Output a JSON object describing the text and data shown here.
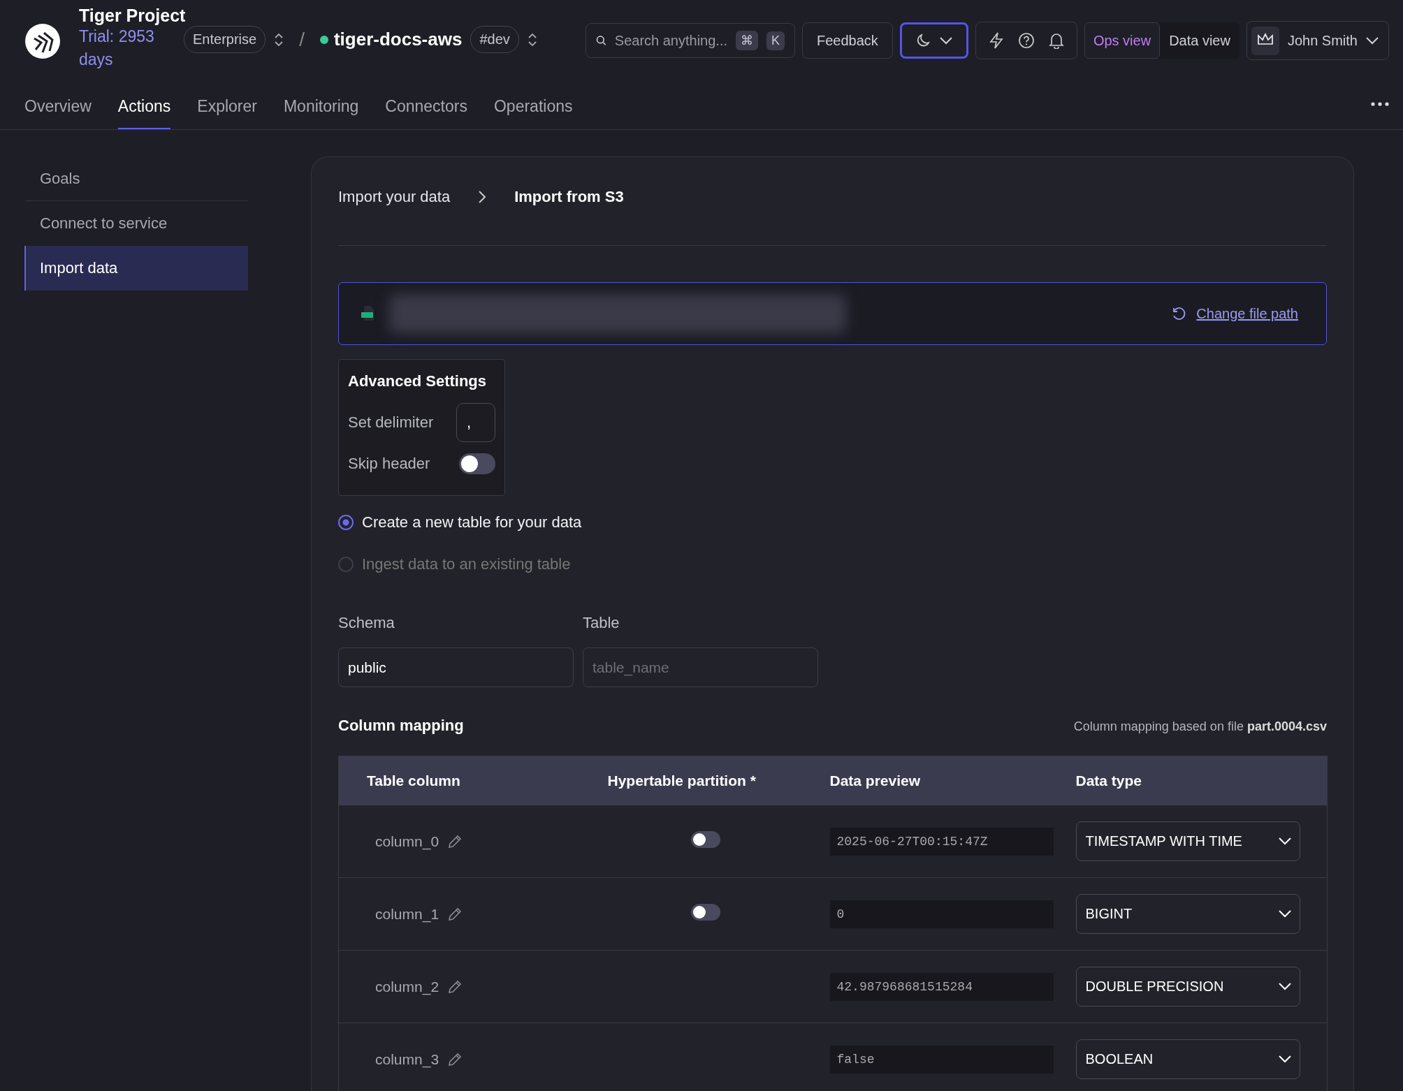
{
  "header": {
    "project_name": "Tiger Project",
    "trial": "Trial: 2953 days",
    "plan": "Enterprise",
    "separator": "/",
    "service": {
      "name": "tiger-docs-aws",
      "color": "#3ec99a",
      "tag": "#dev"
    },
    "search": {
      "placeholder": "Search anything...",
      "shortcut": [
        "⌘",
        "K"
      ]
    },
    "feedback": "Feedback",
    "theme_menu": {
      "focused": true
    },
    "views": [
      {
        "label": "Ops view",
        "selected": true
      },
      {
        "label": "Data view",
        "selected": false
      }
    ],
    "user": {
      "name": "John Smith"
    }
  },
  "tabs": [
    {
      "label": "Overview",
      "selected": false
    },
    {
      "label": "Actions",
      "selected": true
    },
    {
      "label": "Explorer",
      "selected": false
    },
    {
      "label": "Monitoring",
      "selected": false
    },
    {
      "label": "Connectors",
      "selected": false
    },
    {
      "label": "Operations",
      "selected": false
    }
  ],
  "sidebar": {
    "items": [
      {
        "label": "Goals",
        "selected": false
      },
      {
        "label": "Connect to service",
        "selected": false
      },
      {
        "label": "Import data",
        "selected": true
      }
    ]
  },
  "breadcrumb": [
    {
      "label": "Import your data",
      "current": false
    },
    {
      "label": "Import from S3",
      "current": true
    }
  ],
  "file": {
    "link": "Change file path"
  },
  "advanced": {
    "title": "Advanced Settings",
    "delimiter": {
      "label": "Set delimiter",
      "value": ","
    },
    "skip_header": {
      "label": "Skip header",
      "on": false
    }
  },
  "target_options": [
    {
      "label": "Create a new table for your data",
      "selected": true
    },
    {
      "label": "Ingest data to an existing table",
      "selected": false
    }
  ],
  "schema": {
    "label": "Schema",
    "value": "public"
  },
  "table": {
    "label": "Table",
    "placeholder": "table_name"
  },
  "column_mapping": {
    "title": "Column mapping",
    "note": "Column mapping based on file **part.0004.csv**",
    "columns": [
      "Table column",
      "Hypertable partition *",
      "Data preview",
      "Data type"
    ],
    "rows": [
      {
        "name": "column_0",
        "partition": {
          "on": false
        },
        "preview": "2025-06-27T00:15:47Z",
        "type": "TIMESTAMP WITH TIME"
      },
      {
        "name": "column_1",
        "partition": {
          "on": false
        },
        "preview": "0",
        "type": "BIGINT"
      },
      {
        "name": "column_2",
        "preview": "42.987968681515284",
        "type": "DOUBLE PRECISION"
      },
      {
        "name": "column_3",
        "preview": "false",
        "type": "BOOLEAN"
      }
    ]
  }
}
